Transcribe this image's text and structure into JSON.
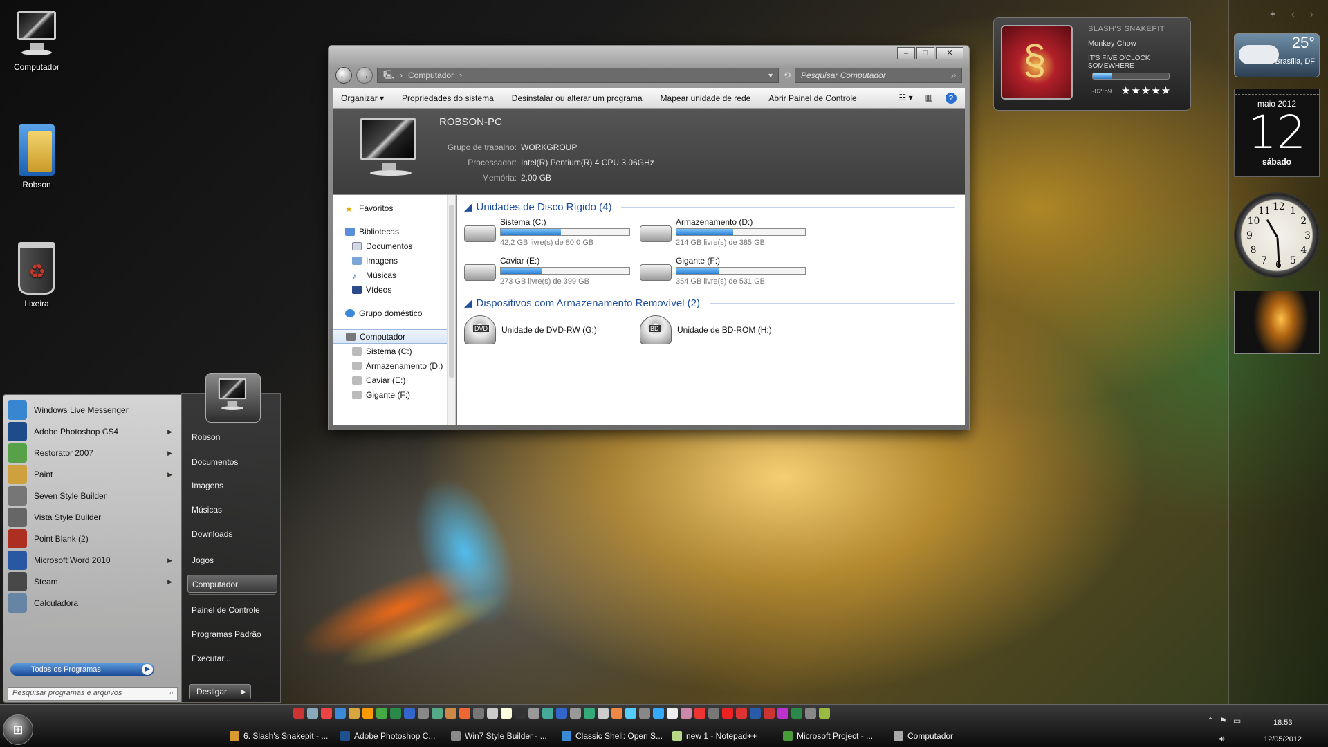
{
  "desktop": {
    "icons": [
      {
        "label": "Computador"
      },
      {
        "label": "Robson"
      },
      {
        "label": "Lixeira"
      }
    ]
  },
  "explorer": {
    "address": "Computador",
    "search_placeholder": "Pesquisar Computador",
    "toolbar": {
      "organize": "Organizar",
      "system_props": "Propriedades do sistema",
      "uninstall": "Desinstalar ou alterar um programa",
      "map_drive": "Mapear unidade de rede",
      "control_panel": "Abrir Painel de Controle"
    },
    "details": {
      "computer_name": "ROBSON-PC",
      "workgroup_label": "Grupo de trabalho:",
      "workgroup_value": "WORKGROUP",
      "processor_label": "Processador:",
      "processor_value": "Intel(R) Pentium(R) 4 CPU 3.06GHz",
      "memory_label": "Memória:",
      "memory_value": "2,00 GB"
    },
    "nav": {
      "favorites": "Favoritos",
      "libraries": "Bibliotecas",
      "documents": "Documentos",
      "images": "Imagens",
      "music": "Músicas",
      "videos": "Vídeos",
      "homegroup": "Grupo doméstico",
      "computer": "Computador",
      "drive_c": "Sistema (C:)",
      "drive_d": "Armazenamento (D:)",
      "drive_e": "Caviar (E:)",
      "drive_f": "Gigante (F:)"
    },
    "hard_disks": {
      "header": "Unidades de Disco Rígido (4)",
      "drives": [
        {
          "name": "Sistema (C:)",
          "free": "42,2 GB livre(s) de 80,0 GB",
          "used_fraction": 0.47
        },
        {
          "name": "Armazenamento (D:)",
          "free": "214 GB livre(s) de 385 GB",
          "used_fraction": 0.44
        },
        {
          "name": "Caviar (E:)",
          "free": "273 GB livre(s) de 399 GB",
          "used_fraction": 0.32
        },
        {
          "name": "Gigante (F:)",
          "free": "354 GB livre(s) de 531 GB",
          "used_fraction": 0.33
        }
      ]
    },
    "removable": {
      "header": "Dispositivos com Armazenamento Removível (2)",
      "devices": [
        {
          "name": "Unidade de DVD-RW (G:)",
          "badge": "DVD"
        },
        {
          "name": "Unidade de BD-ROM (H:)",
          "badge": "BD"
        }
      ]
    }
  },
  "media_gadget": {
    "artist": "SLASH'S SNAKEPIT",
    "album": "Monkey Chow",
    "song": "IT'S FIVE O'CLOCK SOMEWHERE",
    "time": "-02:59",
    "rating_stars": "★★★★★",
    "progress_fraction": 0.25
  },
  "weather": {
    "temp": "25°",
    "city": "Brasília, DF"
  },
  "calendar": {
    "month": "maio 2012",
    "day": "12",
    "weekday": "sábado"
  },
  "clock": {
    "numbers": [
      "12",
      "1",
      "2",
      "3",
      "4",
      "5",
      "6",
      "7",
      "8",
      "9",
      "10",
      "11"
    ]
  },
  "start_menu": {
    "programs": [
      {
        "label": "Windows Live Messenger",
        "color": "#3a8ad8",
        "has_arrow": false
      },
      {
        "label": "Adobe Photoshop CS4",
        "color": "#1f4f8f",
        "has_arrow": true
      },
      {
        "label": "Restorator 2007",
        "color": "#5aa84a",
        "has_arrow": true
      },
      {
        "label": "Paint",
        "color": "#d7a640",
        "has_arrow": true
      },
      {
        "label": "Seven Style Builder",
        "color": "#7a7a7a",
        "has_arrow": false
      },
      {
        "label": "Vista Style Builder",
        "color": "#6a6a6a",
        "has_arrow": false
      },
      {
        "label": "Point Blank (2)",
        "color": "#b43022",
        "has_arrow": false
      },
      {
        "label": "Microsoft Word 2010",
        "color": "#2a5aa8",
        "has_arrow": true
      },
      {
        "label": "Steam",
        "color": "#4a4a4a",
        "has_arrow": true
      },
      {
        "label": "Calculadora",
        "color": "#6a8aaa",
        "has_arrow": false
      }
    ],
    "all_programs": "Todos os Programas",
    "search_placeholder": "Pesquisar programas e arquivos",
    "links": {
      "user": "Robson",
      "documents": "Documentos",
      "images": "Imagens",
      "music": "Músicas",
      "downloads": "Downloads",
      "games": "Jogos",
      "computer": "Computador",
      "control_panel": "Painel de Controle",
      "default_programs": "Programas Padrão",
      "run": "Executar..."
    },
    "shutdown": "Desligar"
  },
  "taskbar": {
    "tasks": [
      {
        "label": "6. Slash's Snakepit - ...",
        "color": "#d89a30"
      },
      {
        "label": "Adobe Photoshop C...",
        "color": "#1f4f8f"
      },
      {
        "label": "Win7 Style Builder - ...",
        "color": "#8a8a8a"
      },
      {
        "label": "Classic Shell: Open S...",
        "color": "#3a8ad8"
      },
      {
        "label": "new  1 - Notepad++",
        "color": "#b8d888"
      },
      {
        "label": "Microsoft Project - ...",
        "color": "#4a9a3a"
      },
      {
        "label": "Computador",
        "color": "#aaaaaa"
      }
    ],
    "quick_launch_colors": [
      "#c33",
      "#8ab",
      "#e44",
      "#3a8ad8",
      "#d7a640",
      "#f90",
      "#4a4",
      "#2a8a4a",
      "#36c",
      "#888",
      "#5a8",
      "#c84",
      "#e63",
      "#777",
      "#ccc",
      "#ffd",
      "#333",
      "#999",
      "#4a9",
      "#36c",
      "#999",
      "#3a7",
      "#ccc",
      "#e84",
      "#5cf",
      "#888",
      "#3af",
      "#eee",
      "#c8a",
      "#e33",
      "#777",
      "#e22",
      "#d33",
      "#2a5aa8",
      "#c33",
      "#b3c",
      "#2a8a4a",
      "#888",
      "#9b4"
    ],
    "clock_time": "18:53",
    "clock_date": "12/05/2012"
  }
}
